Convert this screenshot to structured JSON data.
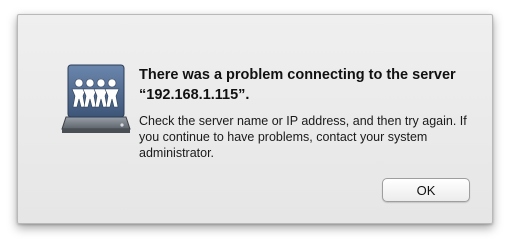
{
  "dialog": {
    "icon": "network-server-icon",
    "title": "There was a problem connecting to the server “192.168.1.115”.",
    "message": "Check the server name or IP address, and then try again. If you continue to have problems, contact your system administrator.",
    "ok_label": "OK"
  }
}
